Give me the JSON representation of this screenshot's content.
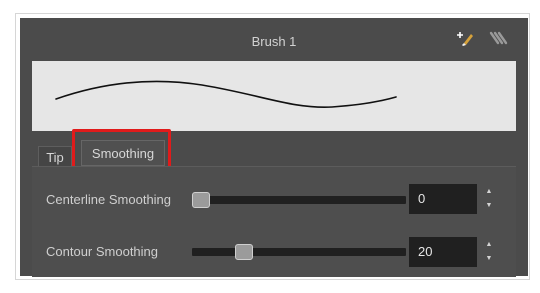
{
  "window": {
    "title": "Brush 1"
  },
  "icons": {
    "new_brush": "new-brush-icon",
    "brush_options": "brush-options-icon"
  },
  "tabs": [
    {
      "label": "Tip"
    },
    {
      "label": "Smoothing"
    }
  ],
  "rows": [
    {
      "label": "Centerline Smoothing",
      "value": "0",
      "slider_fraction": 0.0
    },
    {
      "label": "Contour Smoothing",
      "value": "20",
      "slider_fraction": 0.22
    }
  ],
  "colors": {
    "panel": "#4b4b4b",
    "highlight": "#e01b1b",
    "preview_bg": "#e6e6e6"
  }
}
